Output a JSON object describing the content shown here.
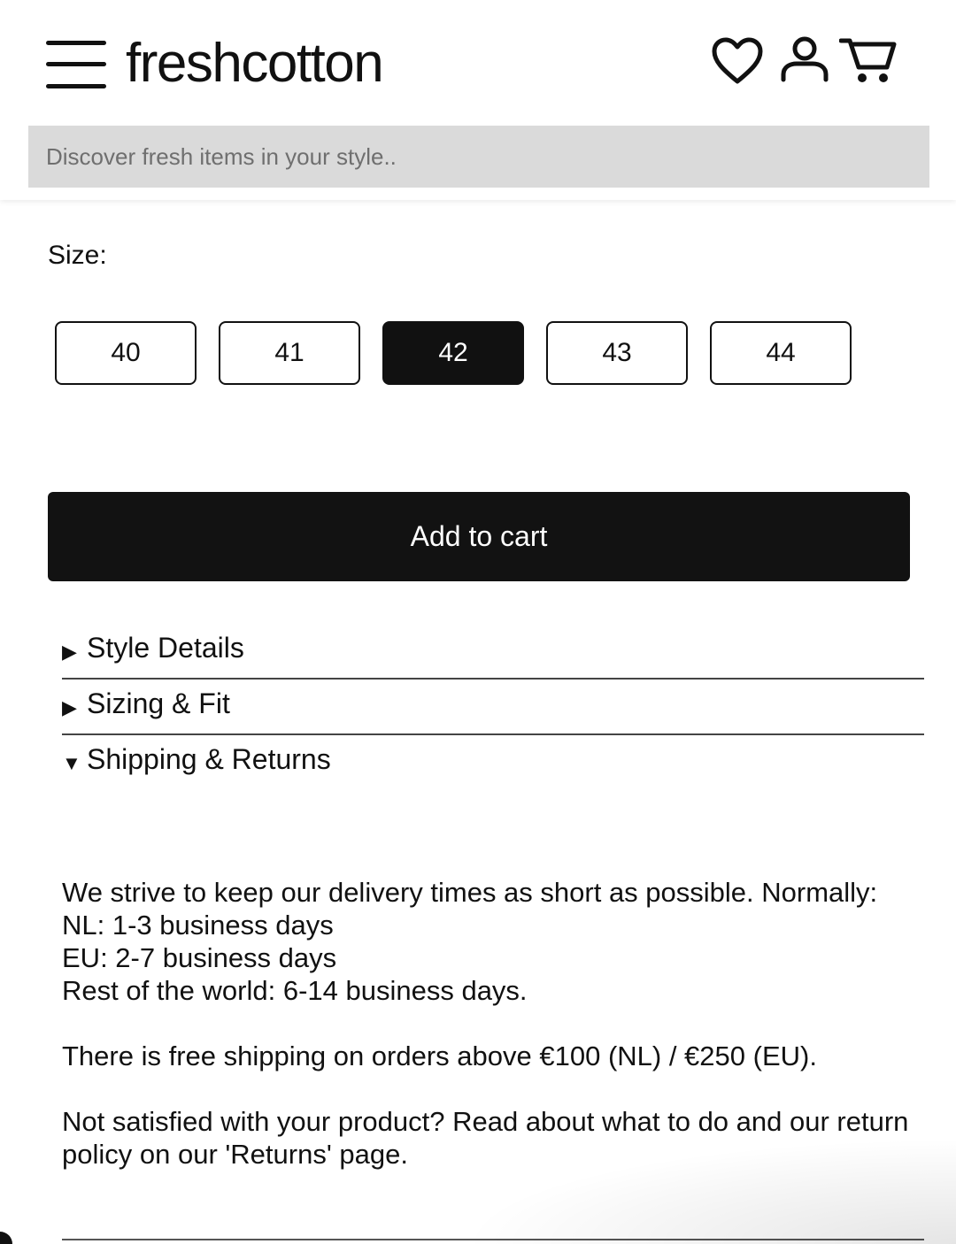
{
  "header": {
    "logo": "freshcotton",
    "search_placeholder": "Discover fresh items in your style..",
    "icons": [
      "menu-icon",
      "heart-icon",
      "user-icon",
      "cart-icon"
    ]
  },
  "product": {
    "size_label": "Size:",
    "sizes": [
      "40",
      "41",
      "42",
      "43",
      "44"
    ],
    "selected_size": "42",
    "add_to_cart": "Add to cart"
  },
  "accordion": {
    "items": [
      {
        "label": "Style Details",
        "expanded": false
      },
      {
        "label": "Sizing & Fit",
        "expanded": false
      },
      {
        "label": "Shipping & Returns",
        "expanded": true
      }
    ],
    "collapsed_glyph": "▶",
    "expanded_glyph": "▼",
    "shipping": {
      "intro": "We strive to keep our delivery times as short as possible. Normally:",
      "nl": "NL: 1-3 business days",
      "eu": "EU: 2-7 business days",
      "rest": "Rest of the world: 6-14 business days.",
      "free_shipping": "There is free shipping on orders above €100 (NL) / €250 (EU).",
      "returns": "Not satisfied with your product? Read about what to do and our return policy on our 'Returns' page."
    }
  },
  "colors": {
    "primary": "#111111",
    "search_bg": "#dadada",
    "background": "#ffffff"
  }
}
